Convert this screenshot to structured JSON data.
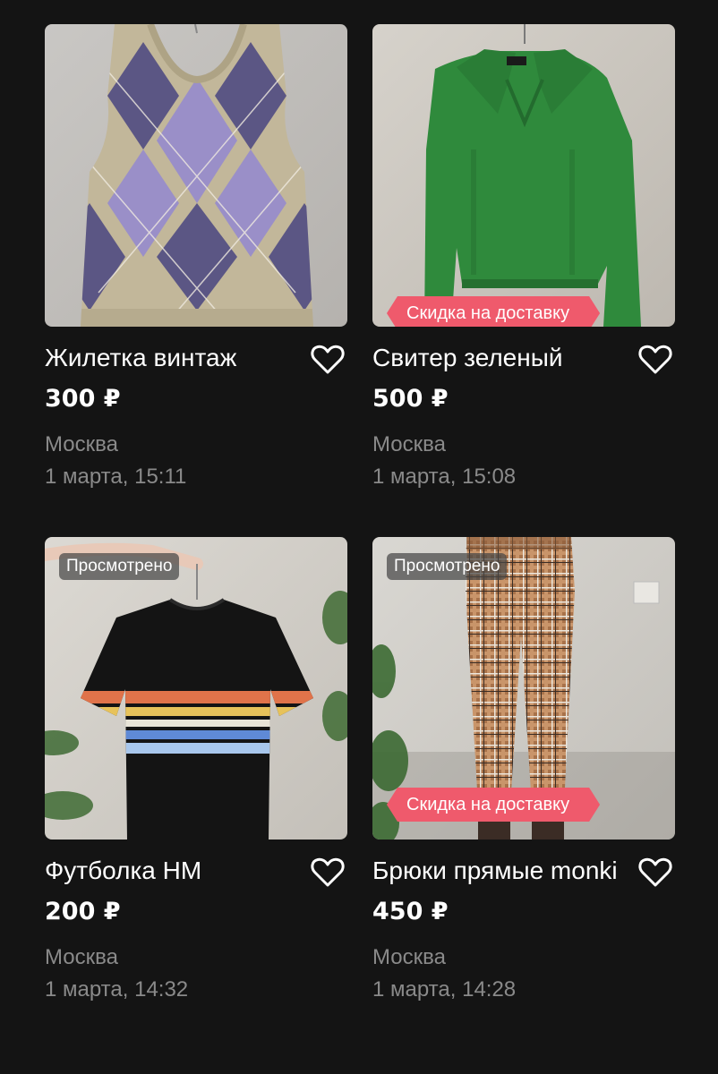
{
  "colors": {
    "background": "#141414",
    "text_primary": "#ffffff",
    "text_secondary": "#8a8a8a",
    "delivery_badge": "#ef5a6c",
    "viewed_badge": "#464646"
  },
  "listings": [
    {
      "title": "Жилетка винтаж",
      "price": "300 ₽",
      "city": "Москва",
      "date": "1 марта, 15:11",
      "image": "argyle-vest-photo",
      "viewed_badge": "",
      "delivery_badge": "",
      "favorite_icon": "heart-outline-icon"
    },
    {
      "title": "Свитер зеленый",
      "price": "500 ₽",
      "city": "Москва",
      "date": "1 марта, 15:08",
      "image": "green-sweater-photo",
      "viewed_badge": "",
      "delivery_badge": "Скидка на доставку",
      "favorite_icon": "heart-outline-icon"
    },
    {
      "title": "Футболка HM",
      "price": "200 ₽",
      "city": "Москва",
      "date": "1 марта, 14:32",
      "image": "striped-tshirt-photo",
      "viewed_badge": "Просмотрено",
      "delivery_badge": "",
      "favorite_icon": "heart-outline-icon"
    },
    {
      "title": "Брюки прямые monki",
      "price": "450 ₽",
      "city": "Москва",
      "date": "1 марта, 14:28",
      "image": "plaid-trousers-photo",
      "viewed_badge": "Просмотрено",
      "delivery_badge": "Скидка на доставку",
      "favorite_icon": "heart-outline-icon"
    }
  ]
}
